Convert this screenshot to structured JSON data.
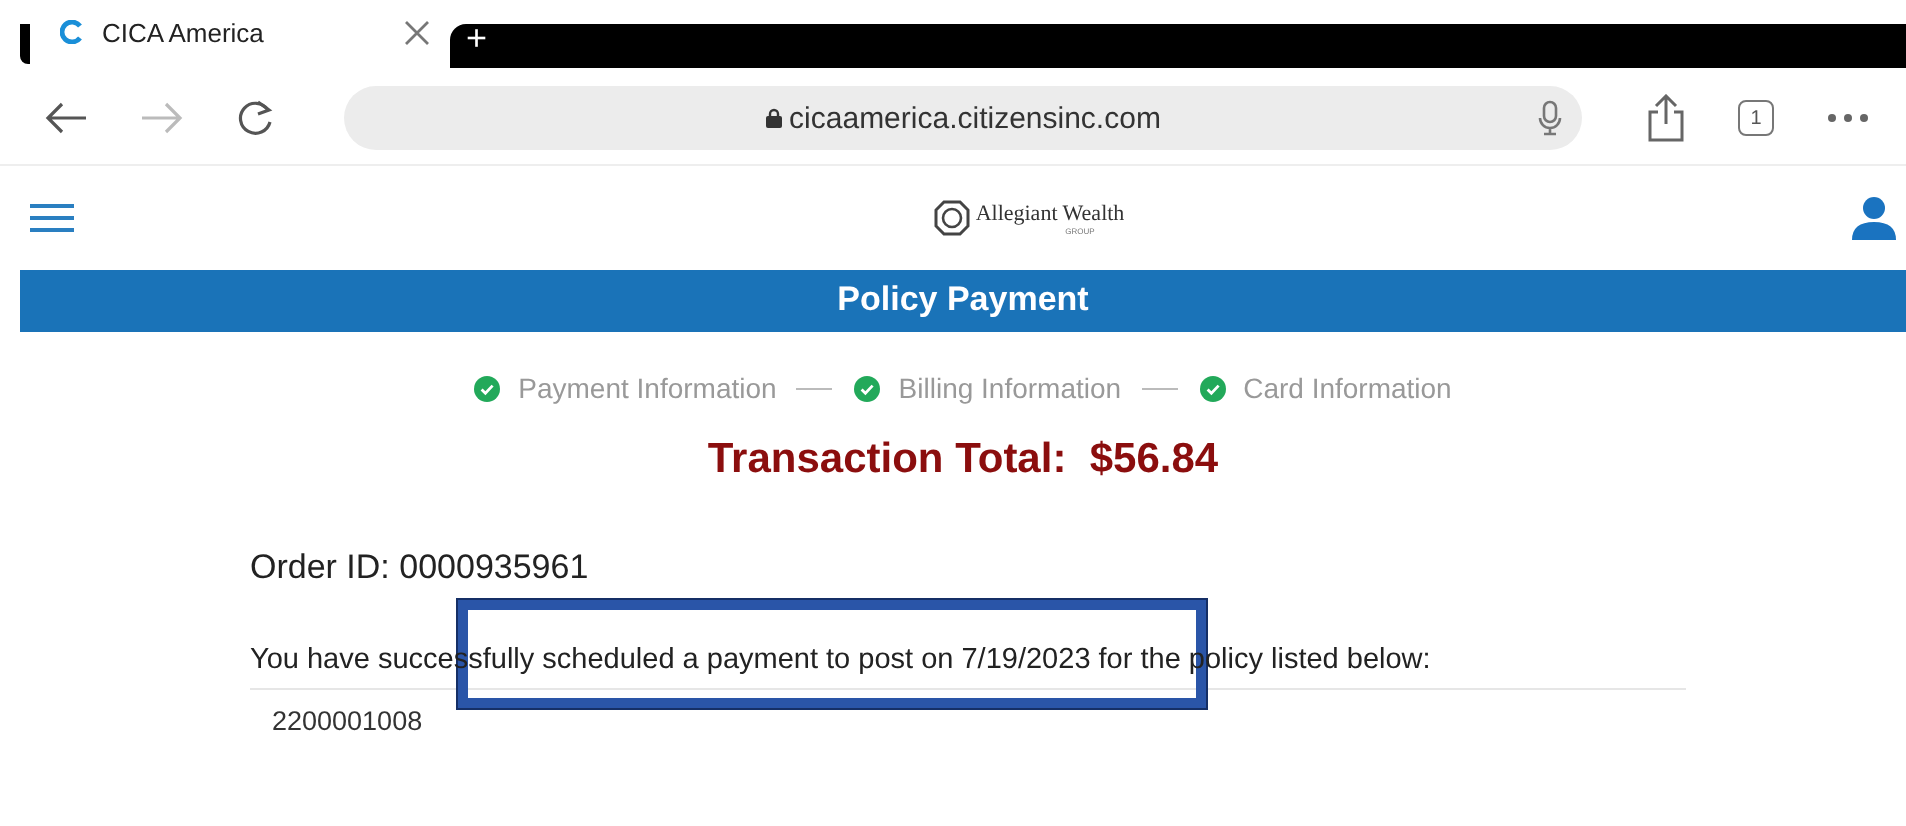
{
  "browser": {
    "tab": {
      "title": "CICA America",
      "selected": true
    },
    "new_tab": "+",
    "url": "cicaamerica.citizensinc.com",
    "tab_count": "1"
  },
  "header": {
    "logo": {
      "name": "Allegiant Wealth",
      "sub": "GROUP"
    }
  },
  "banner": "Policy Payment",
  "steps": [
    {
      "label": "Payment Information",
      "done": true
    },
    {
      "label": "Billing Information",
      "done": true
    },
    {
      "label": "Card Information",
      "done": true
    }
  ],
  "total": "Transaction Total:  $56.84",
  "order_id": "Order ID: 0000935961",
  "message": {
    "text": "You have successfully scheduled a payment to post on 7/19/2023 for the policy listed below:",
    "highlighted": true
  },
  "policies": [
    "2200001008"
  ]
}
